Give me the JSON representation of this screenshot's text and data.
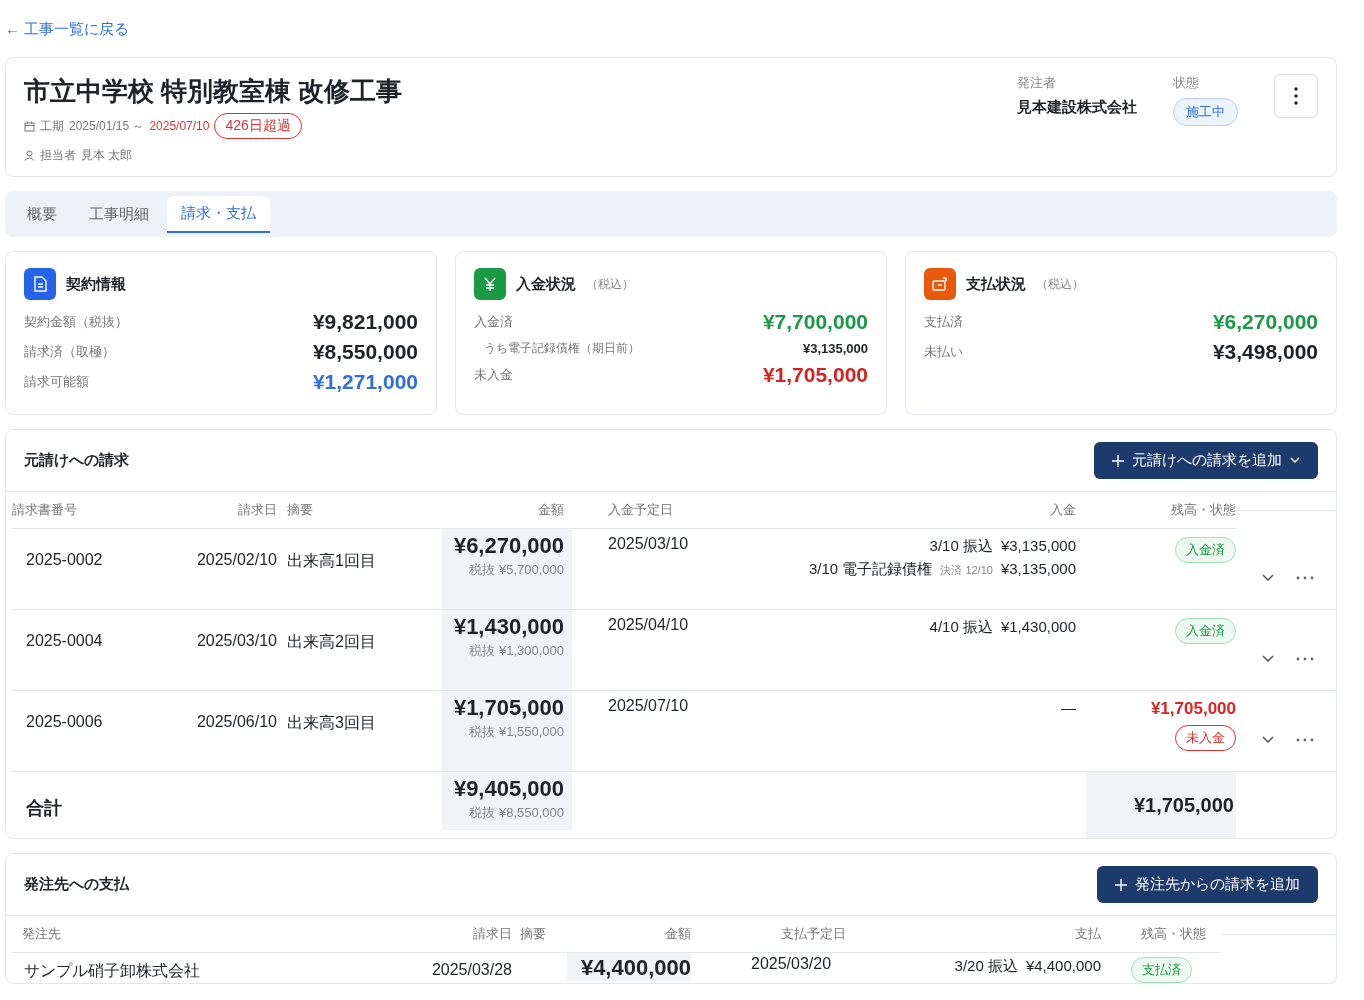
{
  "back_link": "← 工事一覧に戻る",
  "project": {
    "title": "市立中学校 特別教室棟 改修工事",
    "period_label": "工期",
    "period_start": "2025/01/15 ～",
    "period_end": "2025/07/10",
    "overdue_badge": "426日超過",
    "manager_label": "担当者",
    "manager": "見本 太郎",
    "client_label": "発注者",
    "client": "見本建設株式会社",
    "status_label": "状態",
    "status": "施工中"
  },
  "tabs": [
    {
      "label": "概要",
      "selected": false
    },
    {
      "label": "工事明細",
      "selected": false
    },
    {
      "label": "請求・支払",
      "selected": true
    }
  ],
  "summary_cards": [
    {
      "kind": "contract",
      "title": "契約情報",
      "rows": [
        {
          "label": "契約金額（税抜）",
          "value": "¥9,821,000",
          "color": "#1f2328",
          "indented": false
        },
        {
          "label": "請求済（取極）",
          "value": "¥8,550,000",
          "color": "#1f2328",
          "indented": false
        },
        {
          "label": "請求可能額",
          "value": "¥1,271,000",
          "color": "#2f6fd6",
          "indented": false
        }
      ]
    },
    {
      "kind": "income",
      "title": "入金状況",
      "note": "（税込）",
      "rows": [
        {
          "label": "入金済",
          "value": "¥7,700,000",
          "color": "#1a9a45",
          "indented": false
        },
        {
          "label": "うち電子記録債権（期日前）",
          "value": "¥3,135,000",
          "color": "#1f2328",
          "indented": true
        },
        {
          "label": "未入金",
          "value": "¥1,705,000",
          "color": "#d22222",
          "indented": false
        }
      ]
    },
    {
      "kind": "payment",
      "title": "支払状況",
      "note": "（税込）",
      "rows": [
        {
          "label": "支払済",
          "value": "¥6,270,000",
          "color": "#1a9a45",
          "indented": false
        },
        {
          "label": "未払い",
          "value": "¥3,498,000",
          "color": "#1f2328",
          "indented": false
        }
      ]
    }
  ],
  "receivables": {
    "title": "元請けへの請求",
    "add_button": "元請けへの請求を追加",
    "columns": [
      "請求書番号",
      "請求日",
      "摘要",
      "金額",
      "入金予定日",
      "入金",
      "残高・状態"
    ],
    "rows": [
      {
        "number": "2025-0002",
        "date": "2025/02/10",
        "summary": "出来高1回目",
        "amount": "¥6,270,000",
        "amount_ex": "税抜 ¥5,700,000",
        "due": "2025/03/10",
        "payments": [
          {
            "method": "3/10 振込",
            "amount": "¥3,135,000"
          },
          {
            "method": "3/10 電子記録債権",
            "note": "決済 12/10",
            "amount": "¥3,135,000"
          }
        ],
        "status": "入金済",
        "settled": true
      },
      {
        "number": "2025-0004",
        "date": "2025/03/10",
        "summary": "出来高2回目",
        "amount": "¥1,430,000",
        "amount_ex": "税抜 ¥1,300,000",
        "due": "2025/04/10",
        "payments": [
          {
            "method": "4/10 振込",
            "amount": "¥1,430,000"
          }
        ],
        "status": "入金済",
        "settled": true
      },
      {
        "number": "2025-0006",
        "date": "2025/06/10",
        "summary": "出来高3回目",
        "amount": "¥1,705,000",
        "amount_ex": "税抜 ¥1,550,000",
        "due": "2025/07/10",
        "no_payment": "—",
        "balance": "¥1,705,000",
        "status": "未入金",
        "settled": false
      }
    ],
    "total": {
      "label": "合計",
      "amount": "¥9,405,000",
      "amount_ex": "税抜 ¥8,550,000",
      "balance": "¥1,705,000"
    }
  },
  "payables": {
    "title": "発注先への支払",
    "add_button": "発注先からの請求を追加",
    "columns": [
      "発注先",
      "請求日",
      "摘要",
      "金額",
      "支払予定日",
      "支払",
      "残高・状態"
    ],
    "rows": [
      {
        "vendor": "サンプル硝子卸株式会社",
        "date": "2025/03/28",
        "amount": "¥4,400,000",
        "due": "2025/03/20",
        "payments": [
          {
            "method": "3/20 振込",
            "amount": "¥4,400,000"
          }
        ],
        "status": "支払済",
        "settled": true
      }
    ]
  }
}
